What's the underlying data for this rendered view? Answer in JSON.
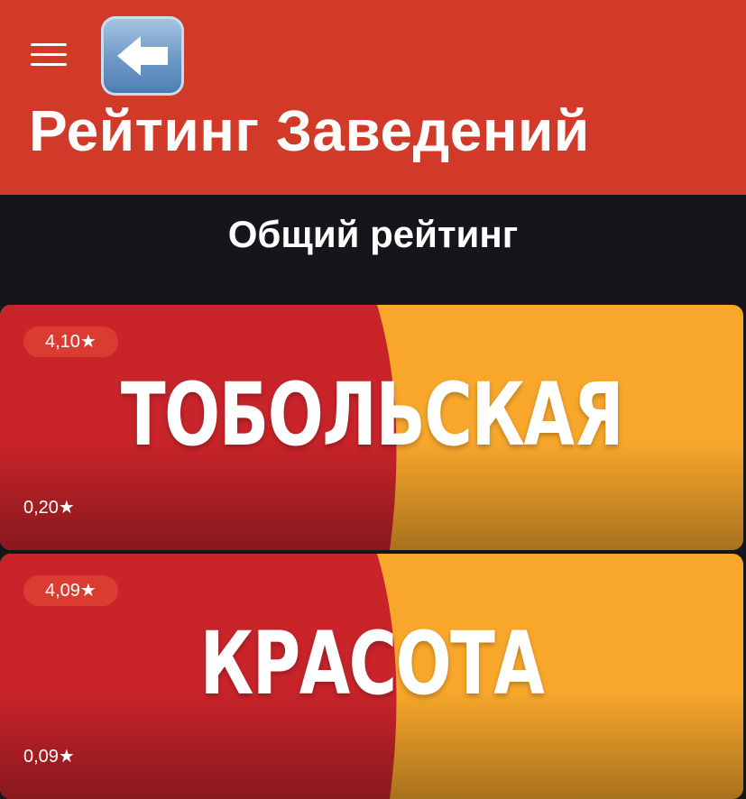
{
  "header": {
    "menu_icon": "hamburger-menu-icon",
    "back_icon": "left-arrow-emoji-icon",
    "title": "Рейтинг Заведений",
    "background_color": "#d13a28"
  },
  "tabs": {
    "active_label": "Общий рейтинг"
  },
  "venues": [
    {
      "name": "ТОБОЛЬСКАЯ",
      "rating_main": "4,10★",
      "rating_secondary": "0,20★"
    },
    {
      "name": "КРАСОТА",
      "rating_main": "4,09★",
      "rating_secondary": "0,09★"
    }
  ],
  "colors": {
    "card_red": "#c8242a",
    "card_yellow": "#f8a72b",
    "tab_bar": "#15161c"
  }
}
